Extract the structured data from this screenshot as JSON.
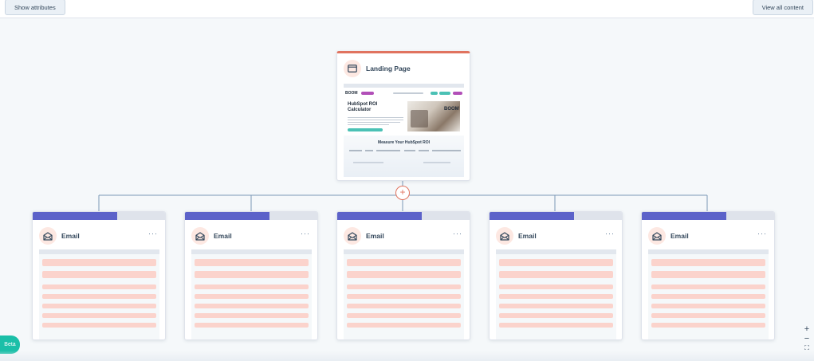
{
  "toolbar": {
    "show_attributes_label": "Show attributes",
    "view_all_label": "View all content"
  },
  "landing_page": {
    "title": "Landing Page",
    "icon": "browser-window-icon",
    "accent_color": "#e0735f",
    "preview": {
      "logo": "BOOM",
      "heading": "HubSpot ROI Calculator",
      "section_title": "Measure Your HubSpot ROI"
    }
  },
  "add_button": {
    "symbol": "+",
    "color": "#e0735f"
  },
  "emails": [
    {
      "title": "Email",
      "menu": "···",
      "icon": "email-icon",
      "progress": 0.63
    },
    {
      "title": "Email",
      "menu": "···",
      "icon": "email-icon",
      "progress": 0.63
    },
    {
      "title": "Email",
      "menu": "···",
      "icon": "email-icon",
      "progress": 0.63
    },
    {
      "title": "Email",
      "menu": "···",
      "icon": "email-icon",
      "progress": 0.63
    },
    {
      "title": "Email",
      "menu": "···",
      "icon": "email-icon",
      "progress": 0.63
    }
  ],
  "colors": {
    "email_bar": "#5c62c9",
    "email_stripe": "#fbd3cc",
    "beta_badge": "#1bbfa8"
  },
  "beta_label": "Beta",
  "zoom_controls": {
    "zoom_in": "+",
    "zoom_out": "−",
    "fit": "⛶"
  }
}
